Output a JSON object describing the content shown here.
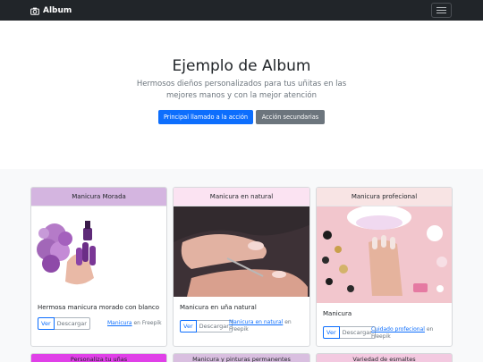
{
  "navbar": {
    "brand": "Album",
    "brand_icon": "camera-icon",
    "toggle_icon": "hamburger-icon"
  },
  "hero": {
    "title": "Ejemplo de Album",
    "lead": "Hermosos dieños personalizados para tus uñitas en las mejores manos y con la mejor atención",
    "primary_button": "Principal llamado a la acción",
    "secondary_button": "Acción secundarias"
  },
  "cards": [
    {
      "header": "Manicura Morada",
      "header_color": "#d4b5e0",
      "text": "Hermosa manicura morado con blanco",
      "view": "Ver",
      "download": "Descargar",
      "credit_link": "Manicura",
      "credit_suffix": " en Freepik"
    },
    {
      "header": "Manicura en natural",
      "header_color": "#fbe3f2",
      "text": "Manicura en uña natural",
      "view": "Ver",
      "download": "Descargar",
      "credit_link": "Manicura en natural",
      "credit_suffix": " en Freepik"
    },
    {
      "header": "Manicura profecional",
      "header_color": "#f8e4e4",
      "text": "Manicura",
      "view": "Ver",
      "download": "Descargar",
      "credit_link": "Cuidado profecional",
      "credit_suffix": " en Freepik"
    }
  ],
  "peek_cards": [
    {
      "header": "Personaliza tu uñas",
      "header_color": "#e040e8"
    },
    {
      "header": "Manicura y pinturas permanentes",
      "header_color": "#d9bfe0"
    },
    {
      "header": "Variedad de esmaltes",
      "header_color": "#f3c9e0"
    }
  ]
}
